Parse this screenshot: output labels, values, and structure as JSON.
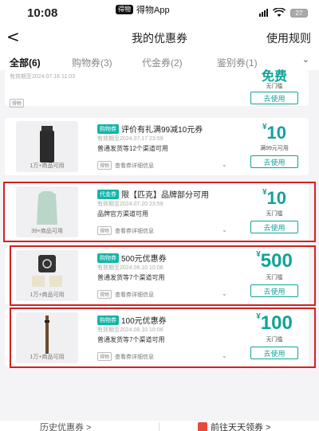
{
  "status_bar": {
    "time": "10:08",
    "app_badge": "得物",
    "app_name": "得物App",
    "battery": "27"
  },
  "nav": {
    "back_glyph": "<",
    "title": "我的优惠券",
    "rules": "使用规则"
  },
  "tabs": [
    {
      "label": "全部(6)",
      "active": true
    },
    {
      "label": "购物券(3)"
    },
    {
      "label": "代金券(2)"
    },
    {
      "label": "鉴别券(1)"
    }
  ],
  "tabs_chevron": "⌄",
  "coupons": [
    {
      "valid": "有效期至2024.07.16 11:03",
      "badge": "得物",
      "amount_partial": "免费",
      "condition": "无门槛",
      "button": "去使用"
    },
    {
      "tag": "购物券",
      "title": "评价有礼满99减10元券",
      "valid": "有效期至2024.07.17 23:59",
      "desc": "普通发货等12个渠道可用",
      "thumb_caption": "1万+商品可用",
      "badge": "得物",
      "detail": "查看券详细信息",
      "currency": "¥",
      "amount": "10",
      "condition": "满99元可用",
      "button": "去使用"
    },
    {
      "tag": "代金券",
      "title": "限【匹克】品牌部分可用",
      "valid": "有效期至2024.07.20 23:59",
      "desc": "品牌官方渠道可用",
      "thumb_caption": "39+商品可用",
      "badge": "得物",
      "detail": "查看券详细信息",
      "currency": "¥",
      "amount": "10",
      "condition": "无门槛",
      "button": "去使用"
    },
    {
      "tag": "购物券",
      "title": "500元优惠券",
      "valid": "有效期至2024.08.10 10:08",
      "desc": "普通发货等7个渠道可用",
      "thumb_caption": "1万+商品可用",
      "badge": "得物",
      "detail": "查看券详细信息",
      "currency": "¥",
      "amount": "500",
      "condition": "无门槛",
      "button": "去使用"
    },
    {
      "tag": "购物券",
      "title": "100元优惠券",
      "valid": "有效期至2024.08.10 10:08",
      "desc": "普通发货等7个渠道可用",
      "thumb_caption": "1万+商品可用",
      "badge": "得物",
      "detail": "查看券详细信息",
      "currency": "¥",
      "amount": "100",
      "condition": "无门槛",
      "button": "去使用"
    }
  ],
  "footer": {
    "history": "历史优惠券 >",
    "go_get": "前往天天领券 >"
  },
  "colors": {
    "accent": "#12a398",
    "tag": "#12b5a8",
    "highlight": "#d62020"
  }
}
